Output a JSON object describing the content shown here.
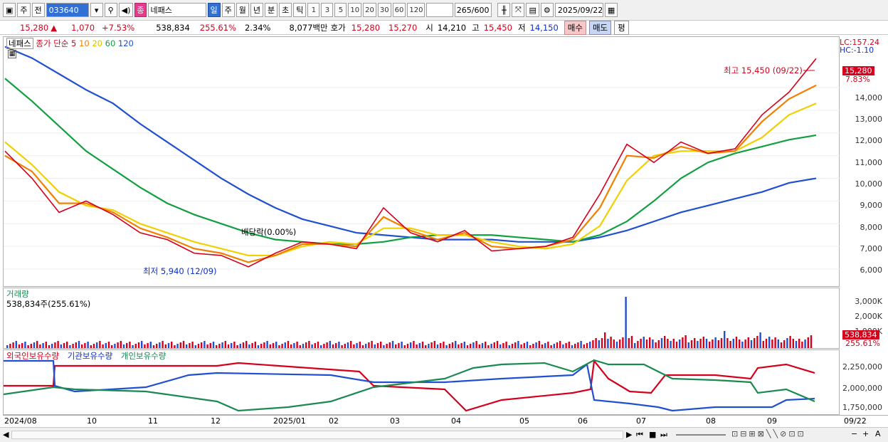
{
  "toolbar": {
    "type_label": "주",
    "prev_label": "전",
    "code": "033640",
    "badge": "종",
    "name": "네패스",
    "periods": [
      "일",
      "주",
      "월",
      "년",
      "분",
      "초",
      "틱"
    ],
    "intervals": [
      "1",
      "3",
      "5",
      "10",
      "20",
      "30",
      "60",
      "120"
    ],
    "count": "265",
    "count_total": "/600",
    "date": "2025/09/22"
  },
  "info": {
    "price": "15,280",
    "arrow": "▲",
    "change": "1,070",
    "change_pct": "+7.53%",
    "volume": "538,834",
    "volume_pct": "255.61%",
    "turnover_pct": "2.34%",
    "amount": "8,077백만",
    "quote_label": "호가",
    "ask": "15,280",
    "bid": "15,270",
    "open_label": "시",
    "open": "14,210",
    "high_label": "고",
    "high": "15,450",
    "low_label": "저",
    "low": "14,150",
    "buy": "매수",
    "sell": "매도",
    "eval": "평"
  },
  "price_panel": {
    "title": "네패스",
    "legend_prefix": "종가 단순",
    "ma": [
      {
        "label": "5",
        "color": "#d4001c"
      },
      {
        "label": "10",
        "color": "#f08000"
      },
      {
        "label": "20",
        "color": "#f0d000"
      },
      {
        "label": "60",
        "color": "#10a040"
      },
      {
        "label": "120",
        "color": "#2050d0"
      }
    ],
    "lc": "LC:157.24",
    "hc": "HC:-1.10",
    "high_annot": "최고 15,450 (09/22)",
    "low_annot": "최저 5,940 (12/09)",
    "div_annot": "배당락(0.00%)",
    "last_price": "15,280",
    "last_pct": "7.83%",
    "ticks": [
      "14,000",
      "13,000",
      "12,000",
      "11,000",
      "10,000",
      "9,000",
      "8,000",
      "7,000",
      "6,000"
    ]
  },
  "volume_panel": {
    "title": "거래량",
    "value": "538,834주(255.61%)",
    "last_value": "538,834",
    "last_pct": "255.61%",
    "ticks": [
      "3,000K",
      "2,000K",
      "1,000K"
    ]
  },
  "holding_panel": {
    "legend": [
      "외국인보유수량",
      "기관보유수량",
      "개인보유수량"
    ],
    "ticks": [
      "2,250,000",
      "2,000,000",
      "1,750,000"
    ]
  },
  "xaxis": {
    "labels": [
      "2024/08",
      "10",
      "11",
      "12",
      "2025/01",
      "02",
      "03",
      "04",
      "05",
      "06",
      "07",
      "08",
      "09",
      "09/22"
    ]
  },
  "chart_data": {
    "type": "line",
    "title": "",
    "ylabel": "",
    "ylim": [
      5500,
      15600
    ],
    "x": [
      "2024/08/05",
      "2024/08/19",
      "2024/09/02",
      "2024/09/16",
      "2024/09/30",
      "2024/10/14",
      "2024/10/28",
      "2024/11/11",
      "2024/11/25",
      "2024/12/09",
      "2024/12/23",
      "2025/01/06",
      "2025/01/20",
      "2025/02/03",
      "2025/02/17",
      "2025/03/03",
      "2025/03/17",
      "2025/03/31",
      "2025/04/14",
      "2025/04/28",
      "2025/05/12",
      "2025/05/26",
      "2025/06/09",
      "2025/06/23",
      "2025/07/07",
      "2025/07/21",
      "2025/08/04",
      "2025/08/18",
      "2025/09/01",
      "2025/09/15",
      "2025/09/22"
    ],
    "series": [
      {
        "name": "5",
        "values": [
          11200,
          10000,
          8500,
          9000,
          8400,
          7600,
          7300,
          6700,
          6600,
          6100,
          6700,
          7200,
          7100,
          6900,
          8700,
          7600,
          7200,
          7700,
          6800,
          6900,
          7000,
          7400,
          9300,
          11500,
          10700,
          11600,
          11100,
          11300,
          12800,
          13800,
          15280
        ]
      },
      {
        "name": "10",
        "values": [
          11000,
          10300,
          8900,
          8900,
          8500,
          7800,
          7400,
          6900,
          6700,
          6300,
          6600,
          7100,
          7100,
          7000,
          8300,
          7700,
          7300,
          7600,
          7000,
          6900,
          7000,
          7300,
          8700,
          11000,
          10900,
          11400,
          11100,
          11200,
          12500,
          13500,
          14100
        ]
      },
      {
        "name": "20",
        "values": [
          11600,
          10600,
          9400,
          8800,
          8600,
          8000,
          7600,
          7200,
          6900,
          6600,
          6600,
          7000,
          7200,
          7100,
          7800,
          7800,
          7500,
          7500,
          7200,
          7000,
          6900,
          7100,
          7900,
          9900,
          11000,
          11200,
          11200,
          11200,
          11800,
          12800,
          13300
        ]
      },
      {
        "name": "60",
        "values": [
          14400,
          13400,
          12300,
          11200,
          10400,
          9600,
          8900,
          8400,
          8000,
          7600,
          7300,
          7200,
          7100,
          7100,
          7200,
          7400,
          7500,
          7500,
          7500,
          7400,
          7300,
          7200,
          7500,
          8100,
          9000,
          10000,
          10700,
          11100,
          11400,
          11700,
          11900
        ]
      },
      {
        "name": "120",
        "values": [
          15800,
          15300,
          14600,
          13900,
          13300,
          12400,
          11600,
          10800,
          10000,
          9300,
          8700,
          8200,
          7900,
          7600,
          7500,
          7400,
          7300,
          7300,
          7300,
          7200,
          7200,
          7200,
          7400,
          7700,
          8100,
          8500,
          8800,
          9100,
          9400,
          9800,
          10000
        ]
      }
    ]
  }
}
